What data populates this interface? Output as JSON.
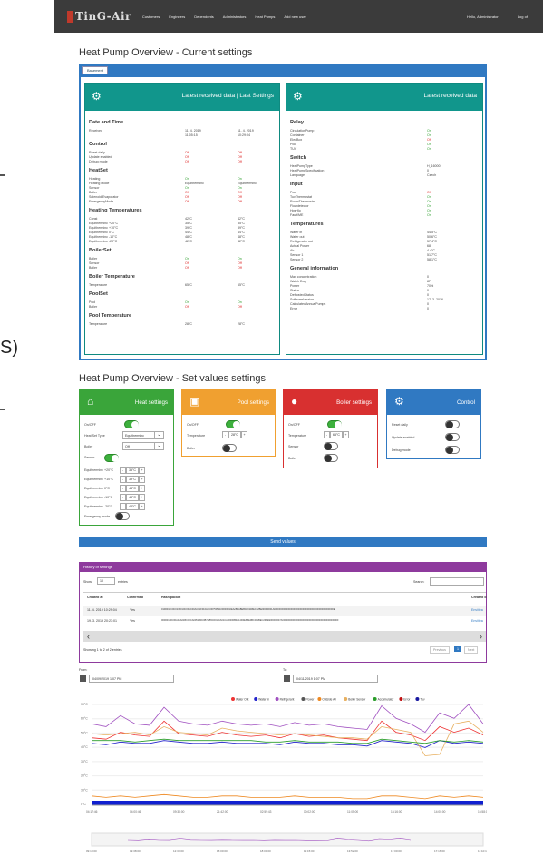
{
  "left_fragment": {
    "text": "S)"
  },
  "nav": {
    "brand": "TinG-Air",
    "links": [
      "Customers",
      "Engineers",
      "Dependents",
      "Administrators",
      "Heat Pumps",
      "Add new user"
    ],
    "right": [
      "Hello, Administrator!",
      "Log off"
    ]
  },
  "overview_title": "Heat Pump Overview - Current settings",
  "tab": "Basement",
  "card_left": {
    "title": "Latest received data | Last Settings",
    "sections": [
      {
        "name": "Date and Time",
        "rows": [
          {
            "label": "Received",
            "v1": "11. 4. 2019 11:05:15",
            "v2": "11. 4. 2019 10:29:04"
          }
        ]
      },
      {
        "name": "Control",
        "rows": [
          {
            "label": "Reset daily",
            "v1": "Off",
            "v2": "Off"
          },
          {
            "label": "Update enabled",
            "v1": "Off",
            "v2": "Off"
          },
          {
            "label": "Debug mode",
            "v1": "Off",
            "v2": "Off"
          }
        ]
      },
      {
        "name": "HeatSet",
        "rows": [
          {
            "label": "Heating",
            "v1": "On",
            "v2": "On"
          },
          {
            "label": "Heating Mode",
            "v1": "Equitherminc",
            "v2": "Equitherminc"
          },
          {
            "label": "Sensor",
            "v1": "On",
            "v2": "On"
          },
          {
            "label": "Boiler",
            "v1": "Off",
            "v2": "Off"
          },
          {
            "label": "Solenoid/Evaporator",
            "v1": "Off",
            "v2": "Off"
          },
          {
            "label": "EmergencyMode",
            "v1": "Off",
            "v2": "Off"
          }
        ]
      },
      {
        "name": "Heating Temperatures",
        "rows": [
          {
            "label": "Const",
            "v1": "42°C",
            "v2": "42°C"
          },
          {
            "label": "Equitherminc +20°C",
            "v1": "35°C",
            "v2": "35°C"
          },
          {
            "label": "Equitherminc +10°C",
            "v1": "39°C",
            "v2": "39°C"
          },
          {
            "label": "Equitherminc 0°C",
            "v1": "44°C",
            "v2": "44°C"
          },
          {
            "label": "Equitherminc -10°C",
            "v1": "48°C",
            "v2": "48°C"
          },
          {
            "label": "Equitherminc -20°C",
            "v1": "42°C",
            "v2": "42°C"
          }
        ]
      },
      {
        "name": "BoilerSet",
        "rows": [
          {
            "label": "Boiler",
            "v1": "On",
            "v2": "On"
          },
          {
            "label": "Sensor",
            "v1": "Off",
            "v2": "Off"
          },
          {
            "label": "Boiler",
            "v1": "Off",
            "v2": "Off"
          }
        ]
      },
      {
        "name": "Boiler Temperature",
        "rows": [
          {
            "label": "Temperature",
            "v1": "65°C",
            "v2": "65°C"
          }
        ]
      },
      {
        "name": "PoolSet",
        "rows": [
          {
            "label": "Pool",
            "v1": "On",
            "v2": "On"
          },
          {
            "label": "Boiler",
            "v1": "Off",
            "v2": "Off"
          }
        ]
      },
      {
        "name": "Pool Temperature",
        "rows": [
          {
            "label": "Temperature",
            "v1": "28°C",
            "v2": "28°C"
          }
        ]
      }
    ]
  },
  "card_right": {
    "title": "Latest received data",
    "sections": [
      {
        "name": "Relay",
        "rows": [
          {
            "label": "CirculationPump",
            "v": "On"
          },
          {
            "label": "Container",
            "v": "On"
          },
          {
            "label": "ElecBox",
            "v": "Off"
          },
          {
            "label": "Pool",
            "v": "On"
          },
          {
            "label": "TUV",
            "v": "On"
          }
        ]
      },
      {
        "name": "Switch",
        "rows": [
          {
            "label": "HeatPumpType",
            "v": "H_16000"
          },
          {
            "label": "HeatPumpSpecification",
            "v": "0"
          },
          {
            "label": "Language",
            "v": "Czech"
          }
        ]
      },
      {
        "name": "Input",
        "rows": [
          {
            "label": "Pool",
            "v": "Off"
          },
          {
            "label": "TuvThermostat",
            "v": "On"
          },
          {
            "label": "RoomThermostat",
            "v": "On"
          },
          {
            "label": "Flowdetector",
            "v": "On"
          },
          {
            "label": "HpsHlo",
            "v": "On"
          },
          {
            "label": "Fault/ME",
            "v": "On"
          }
        ]
      },
      {
        "name": "Temperatures",
        "rows": [
          {
            "label": "Water in",
            "v": "44.5°C"
          },
          {
            "label": "Water out",
            "v": "50.6°C"
          },
          {
            "label": "Refrigerator out",
            "v": "57.4°C"
          },
          {
            "label": "Actual Power",
            "v": "68"
          },
          {
            "label": "Air",
            "v": "4.4°C"
          },
          {
            "label": "Sensor 1",
            "v": "51.7°C"
          },
          {
            "label": "Sensor 2",
            "v": "58.1°C"
          }
        ]
      },
      {
        "name": "General information",
        "rows": [
          {
            "label": "Max concentration",
            "v": "0"
          },
          {
            "label": "Watch Dog",
            "v": "8F"
          },
          {
            "label": "Power",
            "v": "70%"
          },
          {
            "label": "Status",
            "v": "0"
          },
          {
            "label": "DefrostedStatus",
            "v": "0"
          },
          {
            "label": "SoftwareVersion",
            "v": "17. 3. 2016"
          },
          {
            "label": "CalculatedAnnualPumps",
            "v": "0"
          },
          {
            "label": "Error",
            "v": "0"
          }
        ]
      }
    ]
  },
  "set_title": "Heat Pump Overview - Set values settings",
  "heat": {
    "title": "Heat settings",
    "onoff": "On/OFF",
    "type_label": "Heat Set Type",
    "type_value": "Equitherminc",
    "boiler_label": "Boiler",
    "boiler_value": "Off",
    "sensor_label": "Sensor",
    "temps": [
      {
        "label": "Equitherminc +20°C",
        "v": "35°C"
      },
      {
        "label": "Equitherminc +10°C",
        "v": "39°C"
      },
      {
        "label": "Equitherminc 0°C",
        "v": "44°C"
      },
      {
        "label": "Equitherminc -10°C",
        "v": "48°C"
      },
      {
        "label": "Equitherminc -20°C",
        "v": "48°C"
      }
    ],
    "emergency": "Emergency mode"
  },
  "pool": {
    "title": "Pool settings",
    "onoff": "On/OFF",
    "temp_label": "Temperature",
    "temp_value": "28°C",
    "boiler": "Boiler"
  },
  "boiler": {
    "title": "Boiler settings",
    "onoff": "On/OFF",
    "temp_label": "Temperature",
    "temp_value": "65°C",
    "sensor": "Sensor",
    "boiler": "Boiler"
  },
  "control": {
    "title": "Control",
    "reset": "Reset daily",
    "update": "Update enabled",
    "debug": "Debug mode"
  },
  "send": "Send values",
  "history": {
    "title": "History of settings",
    "show": "Show",
    "entries_n": "10",
    "entries": "entries",
    "search": "Search:",
    "cols": [
      "Created at",
      "Confirmed",
      "Hash packet",
      "Created b"
    ],
    "rows": [
      {
        "created": "11. 4. 2019 10:29:04",
        "confirmed": "Yes",
        "hash": "0100010C0C0175010C0FAC00AC01F010A0C0075051100000002EA2B0ABEB1D011BEC22BE90000001AD00000000000000000000000000000000000000000000E",
        "by": "Enviitea"
      },
      {
        "created": "19. 3. 2019 20:23:01",
        "confirmed": "Yes",
        "hash": "00000110C00A01A01BC00CA0051B0C0B7AB5C0011FA01CA00000B0A14D0E6BE0BC011BEC23BE906000007A000000000000000000000000000000000000000000F",
        "by": "Enviitea"
      }
    ],
    "info": "Showing 1 to 2 of 2 entries",
    "prev": "Previous",
    "page": "1",
    "next": "Next"
  },
  "range": {
    "from_label": "From:",
    "from_value": "04/09/2019 1:07 PM",
    "to_label": "To:",
    "to_value": "04/11/2019 1:07 PM"
  },
  "chart_data": {
    "type": "line",
    "legend": [
      "Water Out",
      "Water In",
      "Refrigerant",
      "Power",
      "Outside Air",
      "Boiler Sensor",
      "Accumulator",
      "Error",
      "Tuv"
    ],
    "colors": [
      "#e33",
      "#22c",
      "#a050c0",
      "#555",
      "#ee8820",
      "#e8b060",
      "#2a9d2a",
      "#c01010",
      "#1818a0"
    ],
    "y_ticks": [
      "70°C",
      "60°C",
      "50°C",
      "40°C",
      "30°C",
      "20°C",
      "10°C",
      "0°C"
    ],
    "x_ticks": [
      "04:17:46",
      "04:00:46",
      "09:30:00",
      "21:42:00",
      "02:59:43",
      "10:02:00",
      "11:05:00",
      "13:16:00",
      "14:00:00",
      "16:58:00"
    ],
    "nav_ticks": [
      "09:10:00",
      "09:38:00",
      "12:30:00",
      "15:00:00",
      "18:00:00",
      "11:15:00",
      "13:52:00",
      "17:00:00",
      "17:16:00",
      "11:10:15"
    ],
    "series": [
      {
        "name": "Water Out",
        "values": [
          48,
          47,
          52,
          50,
          49,
          60,
          51,
          50,
          49,
          52,
          50,
          49,
          50,
          48,
          51,
          49,
          50,
          48,
          47,
          46,
          60,
          52,
          50,
          46,
          56,
          52,
          55,
          50
        ]
      },
      {
        "name": "Water In",
        "values": [
          44,
          43,
          45,
          44,
          44,
          46,
          45,
          44,
          44,
          45,
          44,
          44,
          44,
          43,
          45,
          44,
          44,
          43,
          43,
          42,
          46,
          45,
          44,
          41,
          46,
          44,
          45,
          44
        ]
      },
      {
        "name": "Refrigerant",
        "values": [
          58,
          56,
          64,
          58,
          57,
          70,
          60,
          58,
          57,
          60,
          58,
          57,
          58,
          56,
          59,
          57,
          58,
          56,
          55,
          54,
          71,
          62,
          58,
          52,
          66,
          62,
          72,
          58
        ]
      },
      {
        "name": "Boiler Sensor",
        "values": [
          51,
          50,
          51,
          52,
          50,
          56,
          52,
          51,
          50,
          55,
          53,
          52,
          51,
          50,
          51,
          50,
          49,
          48,
          48,
          47,
          56,
          54,
          52,
          35,
          36,
          58,
          60,
          52
        ]
      },
      {
        "name": "Accumulator",
        "values": [
          46,
          46,
          46,
          45,
          46,
          47,
          46,
          46,
          46,
          46,
          46,
          46,
          45,
          45,
          46,
          45,
          45,
          45,
          44,
          44,
          47,
          46,
          45,
          44,
          46,
          45,
          46,
          45
        ]
      },
      {
        "name": "Outside Air",
        "values": [
          6,
          5,
          6,
          5,
          6,
          7,
          6,
          5,
          5,
          6,
          6,
          5,
          5,
          5,
          6,
          5,
          5,
          5,
          4,
          4,
          6,
          6,
          5,
          4,
          6,
          5,
          6,
          5
        ]
      },
      {
        "name": "Error",
        "values": [
          0,
          0,
          0,
          0,
          0,
          0,
          0,
          0,
          0,
          0,
          0,
          0,
          0,
          0,
          0,
          0,
          0,
          0,
          0,
          0,
          0,
          0,
          0,
          0,
          0,
          0,
          0,
          0
        ]
      }
    ],
    "ylim": [
      0,
      72
    ]
  }
}
